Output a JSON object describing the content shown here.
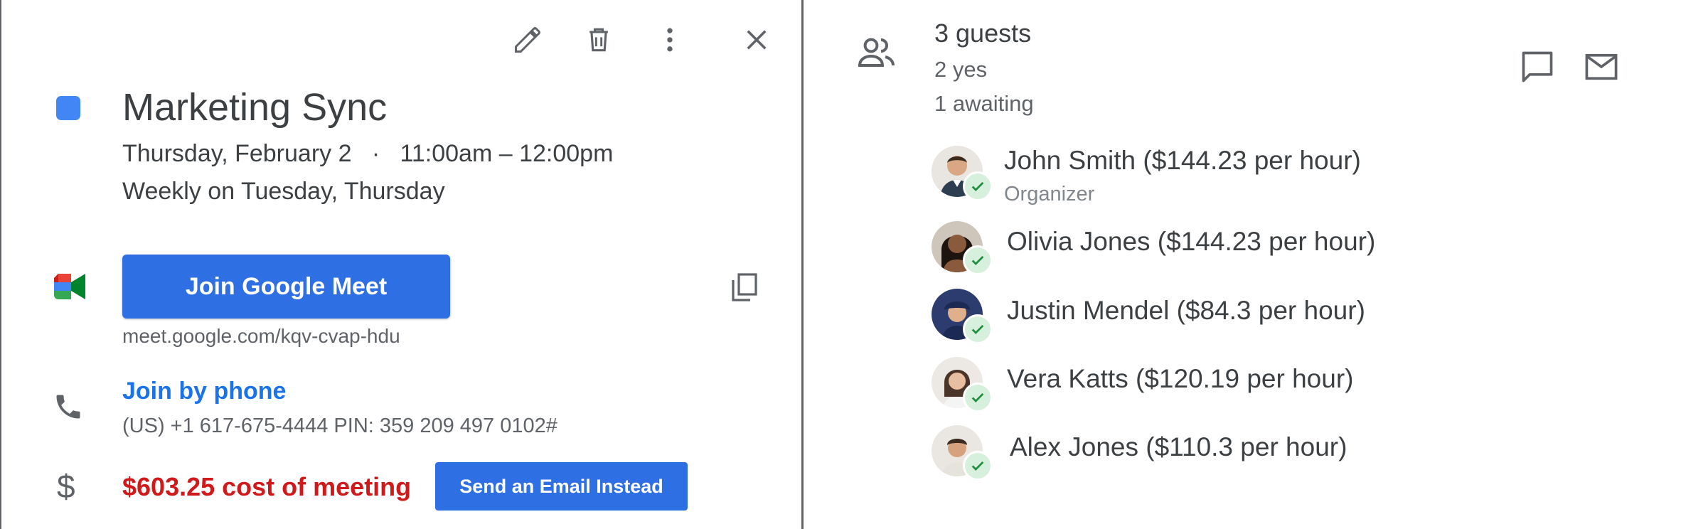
{
  "event": {
    "title": "Marketing Sync",
    "date_line": "Thursday, February 2   ·   11:00am – 12:00pm",
    "recurrence": "Weekly on Tuesday, Thursday",
    "color": "#4285f4"
  },
  "toolbar": {
    "edit_icon": "pencil-icon",
    "delete_icon": "trash-icon",
    "more_icon": "more-vert-icon",
    "close_icon": "close-icon"
  },
  "meet": {
    "button_label": "Join Google Meet",
    "url": "meet.google.com/kqv-cvap-hdu",
    "copy_icon": "copy-icon"
  },
  "phone": {
    "link_label": "Join by phone",
    "details": "(US) +1 617-675-4444 PIN: 359 209 497 0102#"
  },
  "cost": {
    "text": "$603.25 cost of meeting",
    "button_label": "Send an Email Instead",
    "color": "#d0191b"
  },
  "guests": {
    "count_label": "3 guests",
    "yes_label": "2 yes",
    "awaiting_label": "1 awaiting",
    "list": [
      {
        "name": "John Smith ($144.23 per hour)",
        "role": "Organizer",
        "status": "accepted"
      },
      {
        "name": "Olivia Jones ($144.23 per hour)",
        "role": "",
        "status": "accepted"
      },
      {
        "name": "Justin Mendel ($84.3 per hour)",
        "role": "",
        "status": "accepted"
      },
      {
        "name": "Vera Katts ($120.19 per hour)",
        "role": "",
        "status": "accepted"
      },
      {
        "name": "Alex Jones ($110.3 per hour)",
        "role": "",
        "status": "accepted"
      }
    ]
  },
  "colors": {
    "accent": "#2f6fe4",
    "link": "#1a73e8",
    "check_bg": "#d7f0dd",
    "check_mark": "#1e8e3e"
  }
}
